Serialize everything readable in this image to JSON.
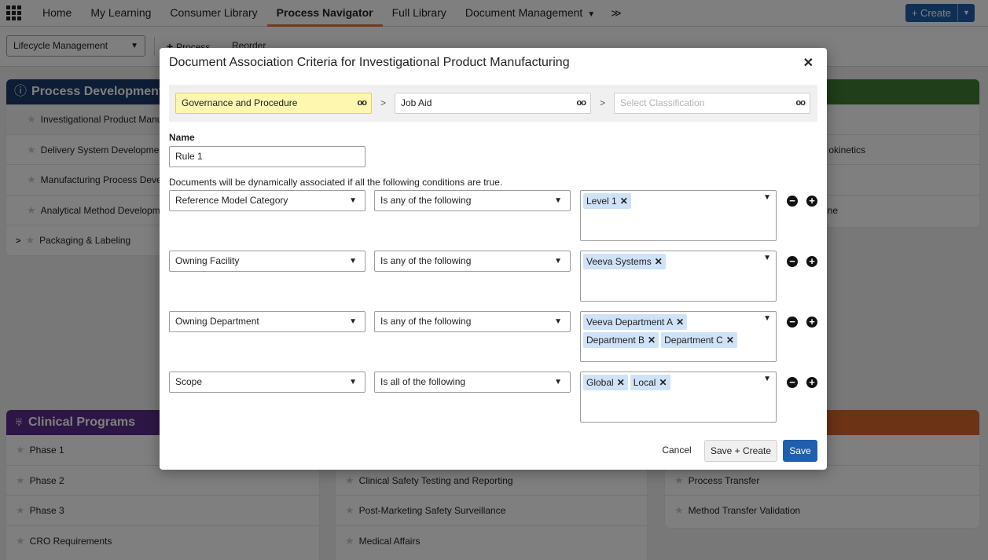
{
  "nav": {
    "items": [
      "Home",
      "My Learning",
      "Consumer Library",
      "Process Navigator",
      "Full Library",
      "Document Management"
    ],
    "active": "Process Navigator",
    "create_label": "Create"
  },
  "toolbar": {
    "lifecycle_select": "Lifecycle Management",
    "add_process": "Process",
    "reorder": "Reorder"
  },
  "background": {
    "process_development": {
      "title": "Process Development",
      "items": [
        "Investigational Product Manu",
        "Delivery System Developme",
        "Manufacturing Process Deve",
        "Analytical Method Developm",
        "Packaging & Labeling"
      ]
    },
    "right_card_1": {
      "items": [
        "okinetics",
        "ine"
      ]
    },
    "clinical_programs": {
      "title": "Clinical Programs",
      "items": [
        "Phase 1",
        "Phase 2",
        "Phase 3",
        "CRO Requirements"
      ]
    },
    "middle_card": {
      "items": [
        "Clinical Safety Testing and Reporting",
        "Post-Marketing Safety Surveillance",
        "Medical Affairs"
      ]
    },
    "right_card_2": {
      "items": [
        "Process Transfer",
        "Method Transfer Validation"
      ]
    },
    "colors": {
      "process_development": "#183a6b",
      "clinical_programs": "#5b2d8a",
      "green": "#3e7d33",
      "orange": "#d9672b"
    }
  },
  "modal": {
    "title": "Document Association Criteria for Investigational Product Manufacturing",
    "classification": {
      "level1": "Governance and Procedure",
      "level2": "Job Aid",
      "level3_placeholder": "Select Classification"
    },
    "name_label": "Name",
    "name_value": "Rule 1",
    "conditions_text": "Documents will be dynamically associated if all the following conditions are true.",
    "rules": [
      {
        "field": "Reference Model Category",
        "operator": "Is any of the following",
        "values": [
          "Level 1"
        ]
      },
      {
        "field": "Owning Facility",
        "operator": "Is any of the following",
        "values": [
          "Veeva Systems"
        ]
      },
      {
        "field": "Owning Department",
        "operator": "Is any of the following",
        "values": [
          "Veeva Department A",
          "Department B",
          "Department C"
        ]
      },
      {
        "field": "Scope",
        "operator": "Is all of the following",
        "values": [
          "Global",
          "Local"
        ]
      }
    ],
    "buttons": {
      "cancel": "Cancel",
      "save_create": "Save + Create",
      "save": "Save"
    }
  }
}
